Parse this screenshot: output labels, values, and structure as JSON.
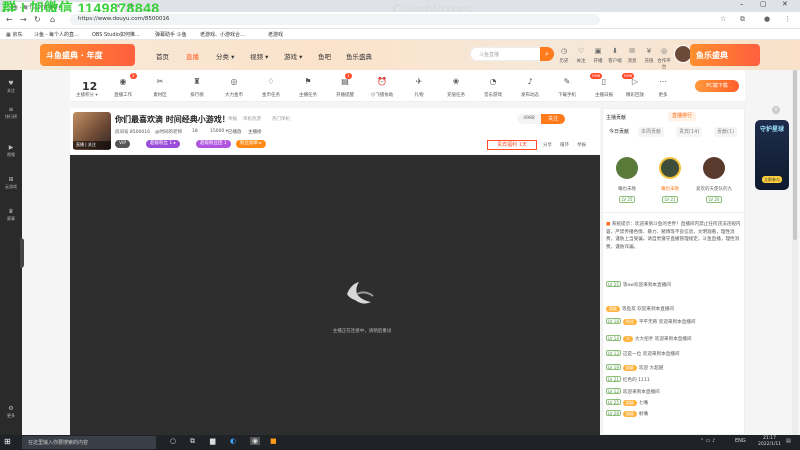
{
  "overlay": {
    "contact": "群 | 加微信 1149878848",
    "title": "Caveblazers"
  },
  "browser": {
    "tab_title": "斗鱼 - 每个人的直播平台",
    "url": "https://www.douyu.com/8500016",
    "bookmarks": [
      "斗鱼 - 每个人的直...",
      "OBS Studio如何推...",
      "弹幕助手 斗鱼",
      "老游戏、小游戏合...",
      "老游戏"
    ]
  },
  "site": {
    "logo_text": "斗鱼盛典 · 年度",
    "nav": [
      "首页",
      "直播",
      "分类 ▾",
      "视频 ▾",
      "游戏 ▾",
      "鱼吧",
      "鱼乐盛典"
    ],
    "search_placeholder": "斗鱼直播",
    "header_icons": [
      {
        "icon": "history-icon",
        "label": "历史"
      },
      {
        "icon": "follow-icon",
        "label": "关注"
      },
      {
        "icon": "broadcast-icon",
        "label": "开播"
      },
      {
        "icon": "client-icon",
        "label": "客户端"
      },
      {
        "icon": "message-icon",
        "label": "消息"
      },
      {
        "icon": "recharge-icon",
        "label": "充值"
      },
      {
        "icon": "friends-icon",
        "label": "合作平台"
      }
    ],
    "banner_right": "鱼乐盛典"
  },
  "leftrail": [
    {
      "icon": "heart-icon",
      "label": "关注"
    },
    {
      "icon": "rank-icon",
      "label": "排行榜"
    },
    {
      "icon": "video-icon",
      "label": "视频"
    },
    {
      "icon": "game-icon",
      "label": "云游戏"
    },
    {
      "icon": "trophy-icon",
      "label": "赛事"
    },
    {
      "icon": "settings-icon",
      "label": "更多"
    }
  ],
  "toolbar": {
    "level": "12",
    "level_label": "主播积分 ▾",
    "items": [
      "直播工作",
      "素材区",
      "排行榜",
      "大力金币",
      "金币任务",
      "主播任务",
      "开播提醒",
      "小飞猪协助",
      "礼物",
      "充值任务",
      "音乐游戏",
      "发布动态",
      "下载手机",
      "主播日报",
      "精彩回放",
      "更多"
    ],
    "pc_button": "PC端下载"
  },
  "stream": {
    "title": "你们最喜欢滴 时间经典小游戏！",
    "meta": [
      "举报",
      "单机热游",
      "热门单机"
    ],
    "thumb_tag": "直播 | 关注",
    "line2": [
      "房间号 8500016",
      "@时间的老师",
      "18",
      "15000 ▾",
      "已播放",
      "主播榜"
    ],
    "chips": [
      {
        "text": "VIP",
        "color": "#555"
      },
      {
        "text": "超级粉丝 1 ▸",
        "color": "#9a4dd9"
      },
      {
        "text": "超级粉丝团 1",
        "color": "#b154e0"
      },
      {
        "text": "粉丝勋章 ▸",
        "color": "#ff8a16"
      }
    ],
    "follow_count": "4988",
    "follow_label": "关注",
    "reward": "贵宾福利 1天",
    "links": [
      "分享",
      "循环",
      "举报"
    ],
    "loading_text": "主播正在连接中，请稍后重试"
  },
  "rightpanel": {
    "header_left": "主播贡献",
    "header_right": "直播排行",
    "tabs": [
      "今日贡献",
      "本周贡献",
      "贵宾(14)",
      "贡献(1)"
    ],
    "ranks": [
      {
        "name": "曦也未晚",
        "lv": "LV 25"
      },
      {
        "name": "曦也未晚",
        "lv": "LV 21"
      },
      {
        "name": "爱欢的天使队的九",
        "lv": "LV 20"
      }
    ],
    "system_msg": "系统提示：欢迎来到斗鱼的世界！直播间内禁止任何违法违规内容，严禁传播色情、暴力、赌博等不良信息，文明观看，理性消费，谨防上当受骗。请自觉遵守直播管理规定。斗鱼直播，理性消费，谨防诈骗。",
    "messages": [
      {
        "lv": "LV 25",
        "badge": "",
        "user": "",
        "text": "等ow欢迎来到本直播间"
      },
      {
        "lv": "",
        "badge": "超级",
        "user": "",
        "text": "等鱼友 欢迎来到本直播间"
      },
      {
        "lv": "LV 18",
        "badge": "粉丝",
        "user": "",
        "text": "平平无奇 欢迎来到本直播间"
      },
      {
        "lv": "LV 14",
        "badge": "大",
        "user": "",
        "text": "大大招手 欢迎来到本直播间"
      },
      {
        "lv": "LV 13",
        "badge": "",
        "user": "",
        "text": "这是一位 欢迎来到本直播间"
      },
      {
        "lv": "LV 19",
        "badge": "超级",
        "user": "",
        "text": "欢迎 大超越"
      },
      {
        "lv": "LV 21",
        "badge": "",
        "user": "",
        "text": "红色的 1111"
      },
      {
        "lv": "LV 12",
        "badge": "",
        "user": "",
        "text": "欢迎来到本直播间"
      },
      {
        "lv": "LV 25",
        "badge": "超级",
        "user": "",
        "text": "七嘴"
      },
      {
        "lv": "LV 28",
        "badge": "超级",
        "user": "",
        "text": "射嘴"
      }
    ]
  },
  "farright": {
    "banner": "守护星球",
    "badge": "立即参与"
  },
  "taskbar": {
    "search_placeholder": "在这里输入你要搜索的内容",
    "lang": "ENG",
    "time": "21:17",
    "date": "2022/1/11"
  }
}
